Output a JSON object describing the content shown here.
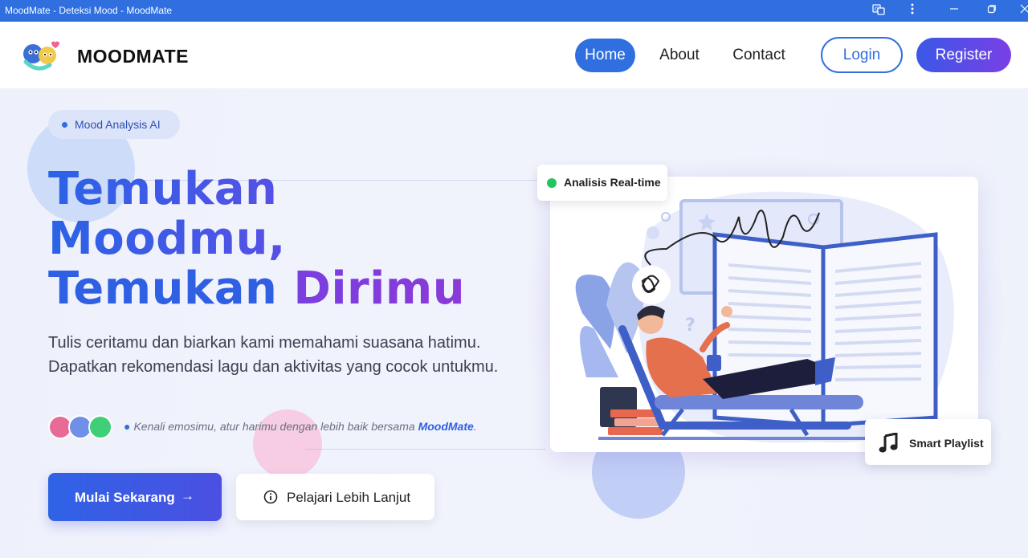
{
  "window": {
    "title": "MoodMate - Deteksi Mood - MoodMate",
    "controls": [
      "translate-icon",
      "more-icon",
      "minimize-icon",
      "restore-icon",
      "close-icon"
    ]
  },
  "nav": {
    "brand": "MOODMATE",
    "links": [
      {
        "label": "Home",
        "active": true
      },
      {
        "label": "About",
        "active": false
      },
      {
        "label": "Contact",
        "active": false
      }
    ],
    "login": "Login",
    "register": "Register"
  },
  "hero": {
    "badge": "Mood Analysis AI",
    "headline": {
      "line1": "Temukan",
      "line2": "Moodmu,",
      "line3_a": "Temukan",
      "line3_b": "Dirimu"
    },
    "subtext": "Tulis ceritamu dan biarkan kami memahami suasana hatimu. Dapatkan rekomendasi lagu dan aktivitas yang cocok untukmu.",
    "tagline_prefix": "Kenali emosimu, atur harimu dengan lebih baik bersama",
    "tagline_brand": "MoodMate",
    "tagline_suffix": ".",
    "primary_button": "Mulai Sekarang",
    "secondary_button": "Pelajari Lebih Lanjut"
  },
  "illustration": {
    "badge_realtime": "Analisis Real-time",
    "badge_playlist": "Smart Playlist"
  },
  "colors": {
    "primary": "#2f6fe0",
    "accent_purple": "#7a3fe0",
    "live_green": "#22c55e"
  }
}
